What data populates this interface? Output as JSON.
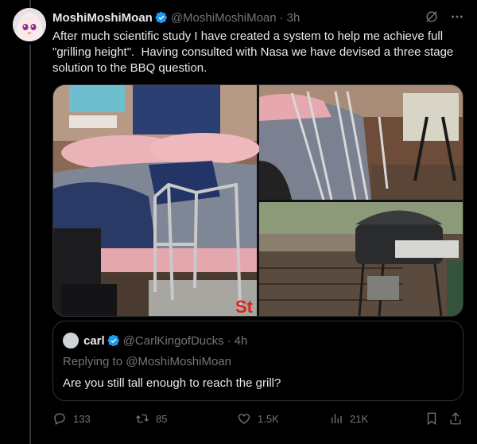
{
  "post": {
    "display_name": "MoshiMoshiMoan",
    "handle": "@MoshiMoshiMoan",
    "separator": "·",
    "time": "3h",
    "text": "After much scientific study I have created a system to help me achieve full \"grilling height\".  Having consulted with Nasa we have devised a three stage solution to the BBQ question."
  },
  "media": {
    "overlay_text": "St"
  },
  "quote": {
    "display_name": "carl",
    "handle": "@CarlKingofDucks",
    "separator": "·",
    "time": "4h",
    "replying_to": "Replying to @MoshiMoshiMoan",
    "text": "Are you still tall enough to reach the grill?"
  },
  "actions": {
    "replies": "133",
    "reposts": "85",
    "likes": "1.5K",
    "views": "21K"
  },
  "colors": {
    "background": "#000000",
    "text": "#e7e9ea",
    "muted": "#71767b",
    "border": "#2f3336",
    "verified": "#1d9bf0",
    "overlay_red": "#e0241b"
  },
  "icons": [
    "verified-icon",
    "grok-icon",
    "more-icon",
    "reply-icon",
    "repost-icon",
    "like-icon",
    "views-icon",
    "bookmark-icon",
    "share-icon"
  ]
}
